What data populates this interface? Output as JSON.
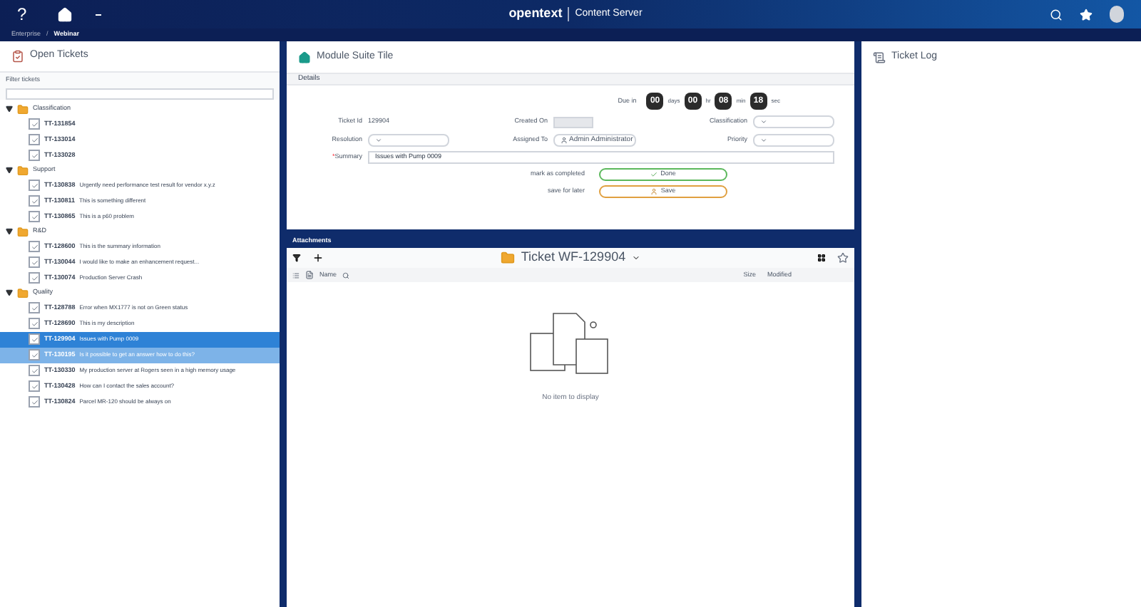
{
  "header": {
    "help": "?",
    "logo": "opentext",
    "product": "Content Server"
  },
  "breadcrumb_separator": "/",
  "breadcrumb": [
    {
      "label": "Enterprise",
      "current": false
    },
    {
      "label": "Webinar",
      "current": true
    }
  ],
  "open_tickets": {
    "title": "Open Tickets",
    "filter_label": "Filter tickets",
    "groups": [
      {
        "name": "Classification",
        "expanded": true,
        "children": [
          {
            "id": "TT-131854",
            "selected": false,
            "hovered": false
          },
          {
            "id": "TT-133014",
            "selected": false,
            "hovered": false
          },
          {
            "id": "TT-133028",
            "selected": false,
            "hovered": false
          }
        ]
      },
      {
        "name": "Support",
        "expanded": true,
        "children": [
          {
            "id": "TT-130838",
            "summary": "Urgently need performance test result for vendor x.y.z",
            "selected": false,
            "hovered": false
          },
          {
            "id": "TT-130811",
            "summary": "This is something different",
            "selected": false,
            "hovered": false
          },
          {
            "id": "TT-130865",
            "summary": "This is a p60 problem",
            "selected": false,
            "hovered": false
          }
        ]
      },
      {
        "name": "R&D",
        "expanded": true,
        "children": [
          {
            "id": "TT-128600",
            "summary": "This is the summary information",
            "selected": false,
            "hovered": false
          },
          {
            "id": "TT-130044",
            "summary": "I would like to make an enhancement request...",
            "selected": false,
            "hovered": false
          },
          {
            "id": "TT-130074",
            "summary": "Production Server Crash",
            "selected": false,
            "hovered": false
          }
        ]
      },
      {
        "name": "Quality",
        "expanded": true,
        "children": [
          {
            "id": "TT-128788",
            "summary": "Error when MX1777 is not on Green status",
            "selected": false,
            "hovered": false
          },
          {
            "id": "TT-128690",
            "summary": "This is my description",
            "selected": false,
            "hovered": false
          },
          {
            "id": "TT-129904",
            "summary": "Issues with Pump 0009",
            "selected": true,
            "hovered": false
          },
          {
            "id": "TT-130195",
            "summary": "Is it possible to get an answer how to do this?",
            "selected": false,
            "hovered": true
          },
          {
            "id": "TT-130330",
            "summary": "My production server at Rogers seen in a high memory usage",
            "selected": false,
            "hovered": false
          },
          {
            "id": "TT-130428",
            "summary": "How can I contact the sales account?",
            "selected": false,
            "hovered": false
          },
          {
            "id": "TT-130824",
            "summary": "Parcel MR-120 should be always on",
            "selected": false,
            "hovered": false
          }
        ]
      }
    ]
  },
  "module_tile": {
    "title": "Module Suite Tile",
    "section": "Details",
    "due_label": "Due in",
    "countdown": [
      {
        "value": "00",
        "unit": "days"
      },
      {
        "value": "00",
        "unit": "hr"
      },
      {
        "value": "08",
        "unit": "min"
      },
      {
        "value": "18",
        "unit": "sec"
      }
    ],
    "ticket_id_label": "Ticket Id",
    "ticket_id": "129904",
    "created_on_label": "Created On",
    "classification_label": "Classification",
    "resolution_label": "Resolution",
    "assigned_to_label": "Assigned To",
    "assigned_to": "Admin Administrator",
    "priority_label": "Priority",
    "summary_label": "Summary",
    "required_mark": "*",
    "summary": "Issues with Pump 0009",
    "actions": [
      {
        "label": "mark as completed",
        "button": "Done",
        "kind": "done"
      },
      {
        "label": "save for later",
        "button": "Save",
        "kind": "save"
      }
    ]
  },
  "attachments": {
    "title": "Attachments",
    "folder": "Ticket WF-129904",
    "columns": [
      "Name",
      "Size",
      "Modified"
    ],
    "empty": "No item to display"
  },
  "ticket_log": {
    "title": "Ticket Log"
  }
}
